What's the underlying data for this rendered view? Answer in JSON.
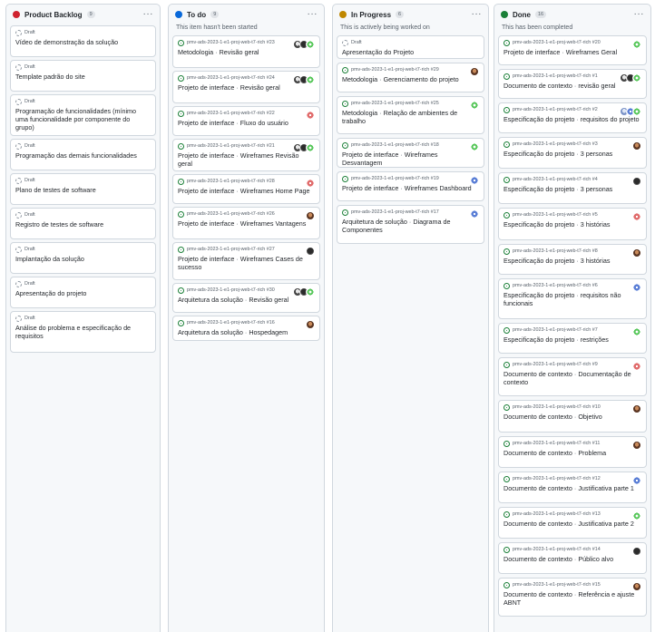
{
  "colors": {
    "backlog": "#cf222e",
    "todo": "#0969da",
    "progress": "#bf8700",
    "done": "#1a7f37"
  },
  "columns": [
    {
      "key": "backlog",
      "title": "Product Backlog",
      "count": "9",
      "more": "···",
      "description": "",
      "cards": [
        {
          "status": "draft",
          "meta": "Draft",
          "parts": [
            "Vídeo de demonstração da solução"
          ],
          "avatars": []
        },
        {
          "status": "draft",
          "meta": "Draft",
          "parts": [
            "Template padrão do site"
          ],
          "avatars": []
        },
        {
          "status": "draft",
          "meta": "Draft",
          "parts": [
            "Programação de funcionalidades (mínimo uma funcionalidade por componente do grupo)"
          ],
          "avatars": []
        },
        {
          "status": "draft",
          "meta": "Draft",
          "parts": [
            "Programação das demais funcionalidades"
          ],
          "avatars": []
        },
        {
          "status": "draft",
          "meta": "Draft",
          "parts": [
            "Plano de testes de software"
          ],
          "avatars": []
        },
        {
          "status": "draft",
          "meta": "Draft",
          "parts": [
            "Registro de testes de software"
          ],
          "avatars": []
        },
        {
          "status": "draft",
          "meta": "Draft",
          "parts": [
            "Implantação da solução"
          ],
          "avatars": []
        },
        {
          "status": "draft",
          "meta": "Draft",
          "parts": [
            "Apresentação do projeto"
          ],
          "avatars": []
        },
        {
          "status": "draft",
          "meta": "Draft",
          "parts": [
            "Análise do problema e especificação de requisitos"
          ],
          "avatars": []
        }
      ]
    },
    {
      "key": "todo",
      "title": "To do",
      "count": "9",
      "more": "···",
      "description": "This item hasn't been started",
      "cards": [
        {
          "status": "open",
          "meta": "pmv-ads-2023-1-e1-proj-web-t7-rich #23",
          "parts": [
            "Metodologia",
            "Revisão geral"
          ],
          "avatars": [
            "mixed",
            "dark",
            "green"
          ]
        },
        {
          "status": "open",
          "meta": "pmv-ads-2023-1-e1-proj-web-t7-rich #24",
          "parts": [
            "Projeto de interface",
            "Revisão geral"
          ],
          "avatars": [
            "mixed",
            "dark",
            "green"
          ]
        },
        {
          "status": "open",
          "meta": "pmv-ads-2023-1-e1-proj-web-t7-rich #22",
          "parts": [
            "Projeto de interface",
            "Fluxo do usuário"
          ],
          "avatars": [
            "red"
          ]
        },
        {
          "status": "open",
          "meta": "pmv-ads-2023-1-e1-proj-web-t7-rich #21",
          "parts": [
            "Projeto de interface",
            "Wireframes Revisão geral"
          ],
          "avatars": [
            "mixed",
            "dark",
            "green"
          ]
        },
        {
          "status": "open",
          "meta": "pmv-ads-2023-1-e1-proj-web-t7-rich #28",
          "parts": [
            "Projeto de interface",
            "Wireframes Home Page"
          ],
          "avatars": [
            "red"
          ]
        },
        {
          "status": "open",
          "meta": "pmv-ads-2023-1-e1-proj-web-t7-rich #26",
          "parts": [
            "Projeto de interface",
            "Wireframes Vantagens"
          ],
          "avatars": [
            "brown"
          ]
        },
        {
          "status": "open",
          "meta": "pmv-ads-2023-1-e1-proj-web-t7-rich #27",
          "parts": [
            "Projeto de interface",
            "Wireframes Cases de sucesso"
          ],
          "avatars": [
            "dark"
          ]
        },
        {
          "status": "open",
          "meta": "pmv-ads-2023-1-e1-proj-web-t7-rich #30",
          "parts": [
            "Arquitetura da solução",
            "Revisão geral"
          ],
          "avatars": [
            "mixed",
            "dark",
            "green"
          ]
        },
        {
          "status": "open",
          "meta": "pmv-ads-2023-1-e1-proj-web-t7-rich #16",
          "parts": [
            "Arquitetura da solução",
            "Hospedagem"
          ],
          "avatars": [
            "brown"
          ]
        }
      ]
    },
    {
      "key": "progress",
      "title": "In Progress",
      "count": "6",
      "more": "···",
      "description": "This is actively being worked on",
      "cards": [
        {
          "status": "draft",
          "meta": "Draft",
          "parts": [
            "Apresentação do Projeto"
          ],
          "avatars": []
        },
        {
          "status": "open",
          "meta": "pmv-ads-2023-1-e1-proj-web-t7-rich #29",
          "parts": [
            "Metodologia",
            "Gerenciamento do projeto"
          ],
          "avatars": [
            "brown"
          ]
        },
        {
          "status": "open",
          "meta": "pmv-ads-2023-1-e1-proj-web-t7-rich #25",
          "parts": [
            "Metodologia",
            "Relação de ambientes de trabalho"
          ],
          "avatars": [
            "green"
          ]
        },
        {
          "status": "open",
          "meta": "pmv-ads-2023-1-e1-proj-web-t7-rich #18",
          "parts": [
            "Projeto de interface",
            "Wireframes Desvantagem"
          ],
          "avatars": [
            "green"
          ]
        },
        {
          "status": "open",
          "meta": "pmv-ads-2023-1-e1-proj-web-t7-rich #19",
          "parts": [
            "Projeto de interface",
            "Wireframes Dashboard"
          ],
          "avatars": [
            "blue"
          ]
        },
        {
          "status": "open",
          "meta": "pmv-ads-2023-1-e1-proj-web-t7-rich #17",
          "parts": [
            "Arquitetura de solução",
            "Diagrama de Componentes"
          ],
          "avatars": [
            "blue"
          ]
        }
      ]
    },
    {
      "key": "done",
      "title": "Done",
      "count": "16",
      "more": "···",
      "description": "This has been completed",
      "cards": [
        {
          "status": "open",
          "meta": "pmv-ads-2023-1-e1-proj-web-t7-rich #20",
          "parts": [
            "Projeto de interface",
            "Wireframes Geral"
          ],
          "avatars": [
            "green"
          ]
        },
        {
          "status": "open",
          "meta": "pmv-ads-2023-1-e1-proj-web-t7-rich #1",
          "parts": [
            "Documento de contexto",
            "revisão geral"
          ],
          "avatars": [
            "mixed",
            "dark",
            "green"
          ]
        },
        {
          "status": "open",
          "meta": "pmv-ads-2023-1-e1-proj-web-t7-rich #2",
          "parts": [
            "Especificação do projeto",
            "requisitos do projeto"
          ],
          "avatars": [
            "light",
            "blue",
            "green"
          ]
        },
        {
          "status": "open",
          "meta": "pmv-ads-2023-1-e1-proj-web-t7-rich #3",
          "parts": [
            "Especificação do projeto",
            "3 personas"
          ],
          "avatars": [
            "brown"
          ]
        },
        {
          "status": "open",
          "meta": "pmv-ads-2023-1-e1-proj-web-t7-rich #4",
          "parts": [
            "Especificação do projeto",
            "3 personas"
          ],
          "avatars": [
            "dark"
          ]
        },
        {
          "status": "open",
          "meta": "pmv-ads-2023-1-e1-proj-web-t7-rich #5",
          "parts": [
            "Especificação do projeto",
            "3 histórias"
          ],
          "avatars": [
            "red"
          ]
        },
        {
          "status": "open",
          "meta": "pmv-ads-2023-1-e1-proj-web-t7-rich #8",
          "parts": [
            "Especificação do projeto",
            "3 histórias"
          ],
          "avatars": [
            "brown"
          ]
        },
        {
          "status": "open",
          "meta": "pmv-ads-2023-1-e1-proj-web-t7-rich #6",
          "parts": [
            "Especificação do projeto",
            "requisitos não funcionais"
          ],
          "avatars": [
            "blue"
          ]
        },
        {
          "status": "open",
          "meta": "pmv-ads-2023-1-e1-proj-web-t7-rich #7",
          "parts": [
            "Especificação do projeto",
            "restrições"
          ],
          "avatars": [
            "green"
          ]
        },
        {
          "status": "open",
          "meta": "pmv-ads-2023-1-e1-proj-web-t7-rich #9",
          "parts": [
            "Documento de contexto",
            "Documentação de contexto"
          ],
          "avatars": [
            "red"
          ]
        },
        {
          "status": "open",
          "meta": "pmv-ads-2023-1-e1-proj-web-t7-rich #10",
          "parts": [
            "Documento de contexto",
            "Objetivo"
          ],
          "avatars": [
            "brown"
          ]
        },
        {
          "status": "open",
          "meta": "pmv-ads-2023-1-e1-proj-web-t7-rich #11",
          "parts": [
            "Documento de contexto",
            "Problema"
          ],
          "avatars": [
            "brown"
          ]
        },
        {
          "status": "open",
          "meta": "pmv-ads-2023-1-e1-proj-web-t7-rich #12",
          "parts": [
            "Documento de contexto",
            "Justificativa parte 1"
          ],
          "avatars": [
            "blue"
          ]
        },
        {
          "status": "open",
          "meta": "pmv-ads-2023-1-e1-proj-web-t7-rich #13",
          "parts": [
            "Documento de contexto",
            "Justificativa parte 2"
          ],
          "avatars": [
            "green"
          ]
        },
        {
          "status": "open",
          "meta": "pmv-ads-2023-1-e1-proj-web-t7-rich #14",
          "parts": [
            "Documento de contexto",
            "Público alvo"
          ],
          "avatars": [
            "dark"
          ]
        },
        {
          "status": "open",
          "meta": "pmv-ads-2023-1-e1-proj-web-t7-rich #15",
          "parts": [
            "Documento de contexto",
            "Referência e ajuste ABNT"
          ],
          "avatars": [
            "brown"
          ]
        }
      ]
    }
  ]
}
